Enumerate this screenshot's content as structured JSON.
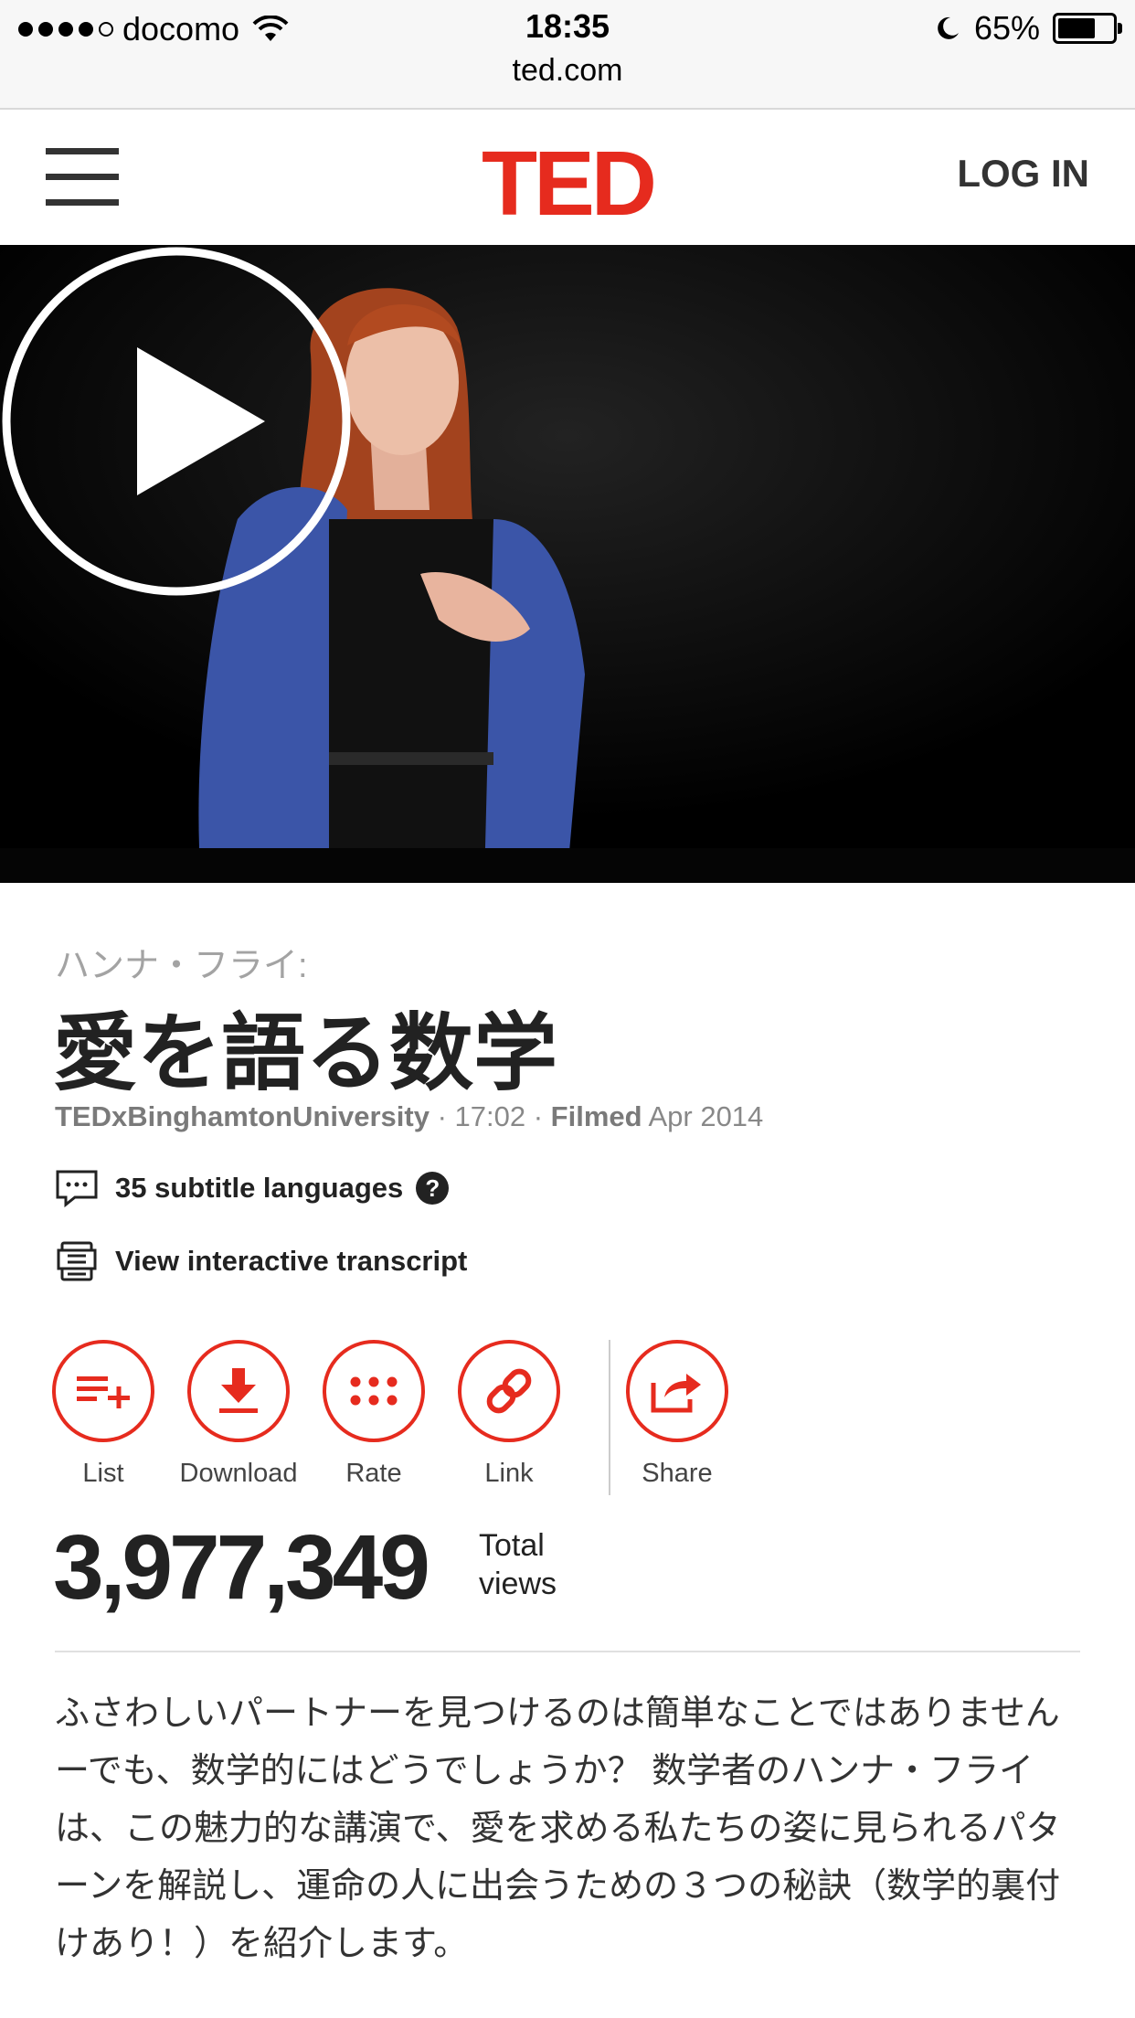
{
  "status_bar": {
    "carrier": "docomo",
    "time": "18:35",
    "url": "ted.com",
    "battery": "65%"
  },
  "header": {
    "logo": "TED",
    "login": "LOG IN"
  },
  "talk": {
    "speaker": "ハンナ・フライ:",
    "title": "愛を語る数学",
    "event": "TEDxBinghamtonUniversity",
    "duration": "· 17:02 ·",
    "filmed_label": "Filmed",
    "filmed_date": "Apr 2014",
    "subtitles": "35 subtitle languages",
    "help": "?",
    "transcript": "View interactive transcript"
  },
  "actions": {
    "list": "List",
    "download": "Download",
    "rate": "Rate",
    "link": "Link",
    "share": "Share"
  },
  "stats": {
    "views": "3,977,349",
    "views_label_1": "Total",
    "views_label_2": "views"
  },
  "description": "ふさわしいパートナーを見つけるのは簡単なことではありませんーでも、数学的にはどうでしょうか？ 数学者のハンナ・フライは、この魅力的な講演で、愛を求める私たちの姿に見られるパターンを解説し、運命の人に出会うための３つの秘訣（数学的裏付けあり！）を紹介します。",
  "colors": {
    "accent": "#e62b1e",
    "text": "#222222"
  },
  "icons": [
    "hamburger-icon",
    "wifi-icon",
    "moon-icon",
    "battery-icon",
    "play-icon",
    "subtitles-icon",
    "transcript-icon",
    "list-add-icon",
    "download-icon",
    "rate-icon",
    "link-icon",
    "share-icon"
  ]
}
